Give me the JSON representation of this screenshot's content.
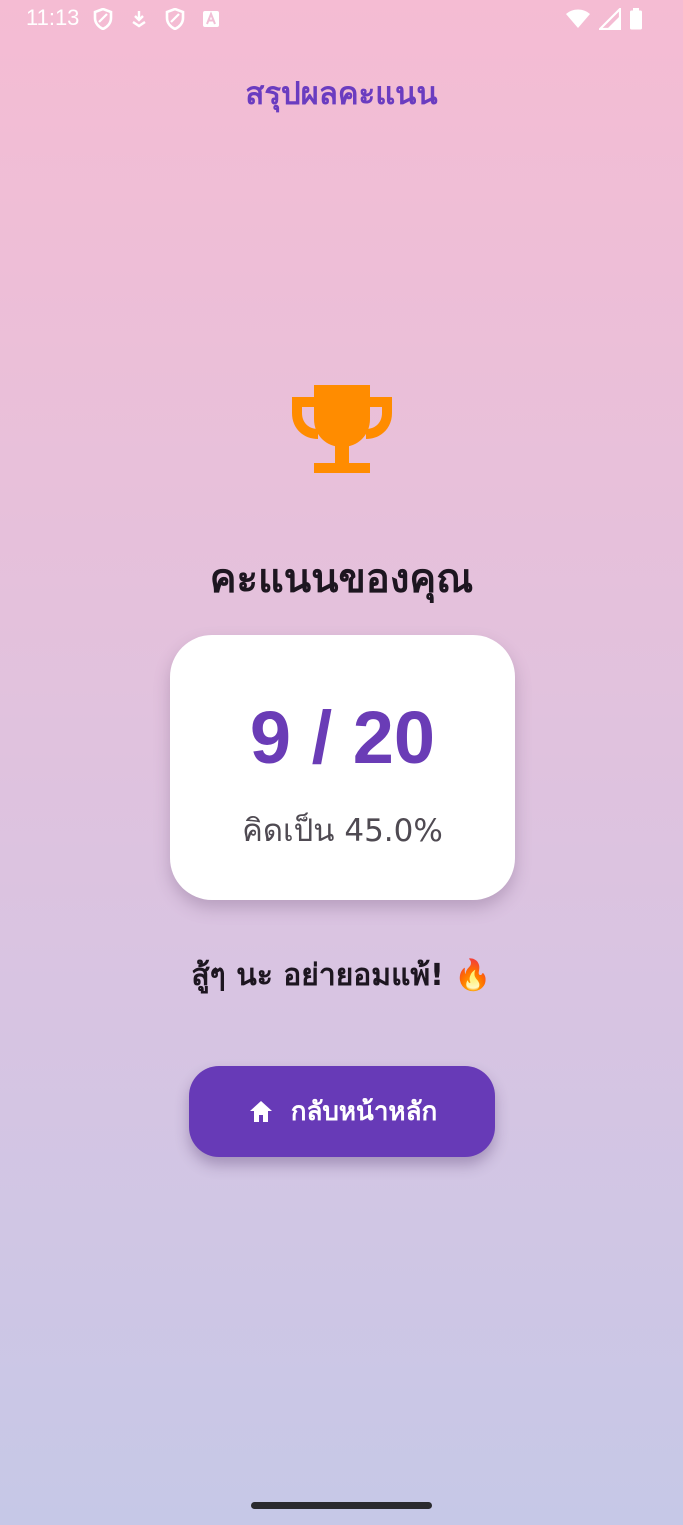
{
  "status_bar": {
    "time": "11:13",
    "left_icons": [
      "shield-icon",
      "download-icon",
      "shield-icon",
      "text-a-icon"
    ],
    "right_icons": [
      "wifi-icon",
      "signal-icon",
      "battery-icon"
    ]
  },
  "app": {
    "title": "สรุปผลคะแนน"
  },
  "result": {
    "trophy_icon": "trophy-icon",
    "heading": "คะแนนของคุณ",
    "score_text": "9 / 20",
    "percent_text": "คิดเป็น 45.0%",
    "message": "สู้ๆ นะ อย่ายอมแพ้! 🔥"
  },
  "actions": {
    "home_icon": "home-icon",
    "home_label": "กลับหน้าหลัก"
  },
  "colors": {
    "accent": "#673ab7",
    "title": "#6a3cc0",
    "trophy": "#ff8c00",
    "card": "#ffffff"
  }
}
